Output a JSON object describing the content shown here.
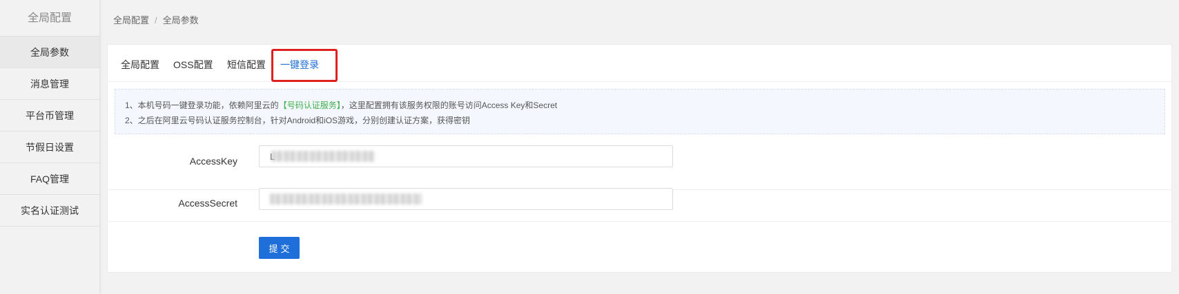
{
  "sidebar": {
    "title": "全局配置",
    "items": [
      {
        "label": "全局参数"
      },
      {
        "label": "消息管理"
      },
      {
        "label": "平台币管理"
      },
      {
        "label": "节假日设置"
      },
      {
        "label": "FAQ管理"
      },
      {
        "label": "实名认证测试"
      }
    ]
  },
  "breadcrumb": {
    "items": [
      "全局配置",
      "全局参数"
    ],
    "separator": "/"
  },
  "tabs": [
    {
      "label": "全局配置"
    },
    {
      "label": "OSS配置"
    },
    {
      "label": "短信配置"
    },
    {
      "label": "一键登录"
    }
  ],
  "notice": {
    "line1_prefix": "1、本机号码一键登录功能，依赖阿里云的",
    "line1_highlight": "【号码认证服务】",
    "line1_suffix": "，这里配置拥有该服务权限的账号访问Access Key和Secret",
    "line2": "2、之后在阿里云号码认证服务控制台，针对Android和iOS游戏，分别创建认证方案，获得密钥"
  },
  "form": {
    "access_key": {
      "label": "AccessKey",
      "value": "L"
    },
    "access_secret": {
      "label": "AccessSecret",
      "value": ""
    },
    "submit_label": "提交"
  },
  "colors": {
    "accent": "#1e6fd9",
    "highlight_green": "#3fb04a",
    "annotation_red": "#e0201f"
  }
}
